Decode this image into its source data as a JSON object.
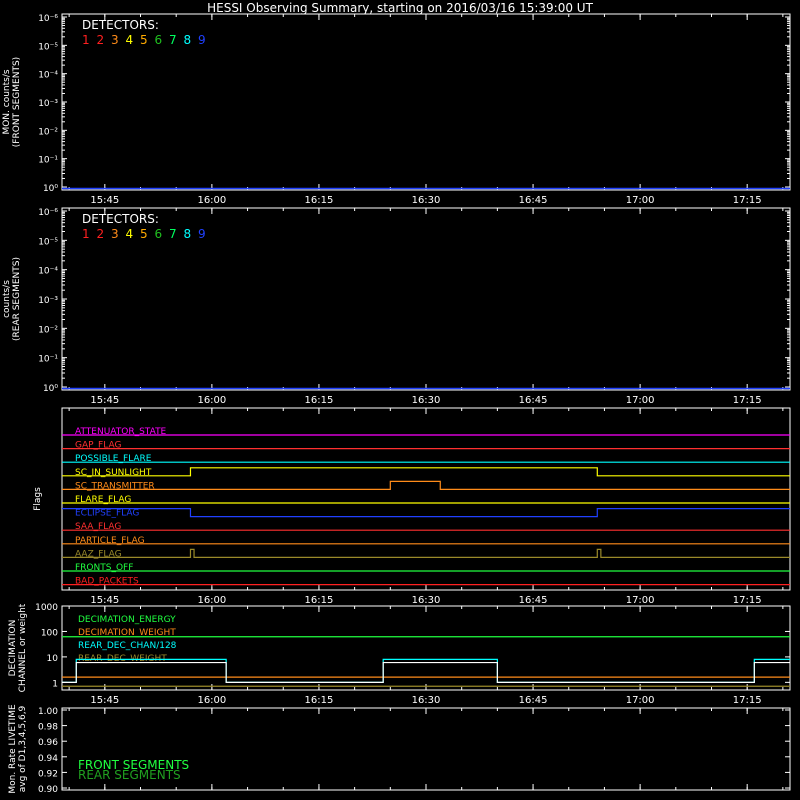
{
  "title": "HESSI Observing Summary, starting on 2016/03/16 15:39:00 UT",
  "time_axis": {
    "start": "15:39:00",
    "end": "17:21:00",
    "tick_labels": [
      "15:45",
      "16:00",
      "16:15",
      "16:30",
      "16:45",
      "17:00",
      "17:15"
    ],
    "tick_times": [
      "15:45",
      "16:00",
      "16:15",
      "16:30",
      "16:45",
      "17:00",
      "17:15"
    ]
  },
  "colors": {
    "background": "#000000",
    "axes": "#ffffff",
    "d1": "#ff2020",
    "d2": "#ff2020",
    "d3": "#ff8c1a",
    "d4": "#ffff00",
    "d5": "#ffaa00",
    "d6": "#20c020",
    "d7": "#00ff60",
    "d8": "#00ffff",
    "d9": "#2040ff"
  },
  "chart_data": [
    {
      "id": "front",
      "type": "line",
      "ylabel_lines": [
        "MON. counts/s",
        "(FRONT SEGMENTS)"
      ],
      "yscale": "log",
      "ylim": [
        1,
        100000
      ],
      "ytick_labels": [
        "10⁰",
        "10⁻¹",
        "10⁻²",
        "10⁻³",
        "10⁻⁴",
        "10⁻⁵",
        "10⁻⁶"
      ],
      "legend_title": "DETECTORS:",
      "legend": [
        {
          "label": "1",
          "color": "#ff2020"
        },
        {
          "label": "2",
          "color": "#ff2020"
        },
        {
          "label": "3",
          "color": "#ff8c1a"
        },
        {
          "label": "4",
          "color": "#ffff00"
        },
        {
          "label": "5",
          "color": "#ffaa00"
        },
        {
          "label": "6",
          "color": "#20c020"
        },
        {
          "label": "7",
          "color": "#00ff60"
        },
        {
          "label": "8",
          "color": "#00ffff"
        },
        {
          "label": "9",
          "color": "#2040ff"
        }
      ],
      "series": [
        {
          "color": "#2040ff",
          "x": [
            "15:39",
            "17:21"
          ],
          "y": [
            1,
            1
          ]
        }
      ]
    },
    {
      "id": "rear",
      "type": "line",
      "ylabel_lines": [
        "counts/s",
        "(REAR SEGMENTS)"
      ],
      "yscale": "log",
      "ylim": [
        1,
        100000
      ],
      "ytick_labels": [
        "10⁰",
        "10⁻¹",
        "10⁻²",
        "10⁻³",
        "10⁻⁴",
        "10⁻⁵",
        "10⁻⁶"
      ],
      "legend_title": "DETECTORS:",
      "legend": [
        {
          "label": "1",
          "color": "#ff2020"
        },
        {
          "label": "2",
          "color": "#ff2020"
        },
        {
          "label": "3",
          "color": "#ff8c1a"
        },
        {
          "label": "4",
          "color": "#ffff00"
        },
        {
          "label": "5",
          "color": "#ffaa00"
        },
        {
          "label": "6",
          "color": "#20c020"
        },
        {
          "label": "7",
          "color": "#00ff60"
        },
        {
          "label": "8",
          "color": "#00ffff"
        },
        {
          "label": "9",
          "color": "#2040ff"
        }
      ],
      "series": [
        {
          "color": "#2040ff",
          "x": [
            "15:39",
            "17:21"
          ],
          "y": [
            1,
            1
          ]
        }
      ]
    },
    {
      "id": "flags",
      "type": "line",
      "ylabel_lines": [
        "Flags"
      ],
      "flags": [
        {
          "name": "ATTENUATOR_STATE",
          "color": "#ff00ff",
          "changes": []
        },
        {
          "name": "GAP_FLAG",
          "color": "#ff3030",
          "changes": []
        },
        {
          "name": "POSSIBLE_FLARE",
          "color": "#00ffff",
          "changes": []
        },
        {
          "name": "SC_IN_SUNLIGHT",
          "color": "#ffff00",
          "changes": [
            [
              "15:39",
              0
            ],
            [
              "15:57",
              1
            ],
            [
              "16:54",
              0
            ]
          ]
        },
        {
          "name": "SC_TRANSMITTER",
          "color": "#ff8c1a",
          "changes": [
            [
              "15:39",
              0
            ],
            [
              "16:25",
              1
            ],
            [
              "16:32",
              0
            ]
          ]
        },
        {
          "name": "FLARE_FLAG",
          "color": "#ffff00",
          "changes": []
        },
        {
          "name": "ECLIPSE_FLAG",
          "color": "#2040ff",
          "changes": [
            [
              "15:39",
              1
            ],
            [
              "15:57",
              0
            ],
            [
              "16:54",
              1
            ]
          ]
        },
        {
          "name": "SAA_FLAG",
          "color": "#ff3030",
          "changes": []
        },
        {
          "name": "PARTICLE_FLAG",
          "color": "#ff8c1a",
          "changes": []
        },
        {
          "name": "AAZ_FLAG",
          "color": "#9a8a2a",
          "changes": [
            [
              "15:39",
              0
            ],
            [
              "15:57",
              1
            ],
            [
              "15:57.5",
              0
            ],
            [
              "16:54",
              1
            ],
            [
              "16:54.5",
              0
            ]
          ]
        },
        {
          "name": "FRONTS_OFF",
          "color": "#20ff40",
          "changes": []
        },
        {
          "name": "BAD_PACKETS",
          "color": "#ff2020",
          "changes": []
        }
      ]
    },
    {
      "id": "decimation",
      "type": "line",
      "ylabel_lines": [
        "DECIMATION",
        "CHANNEL or weight"
      ],
      "yscale": "log",
      "ylim": [
        0.5,
        1000
      ],
      "ytick_labels": [
        "1000",
        "100",
        "10",
        "1"
      ],
      "legend": [
        {
          "label": "DECIMATION_ENERGY",
          "color": "#20ff40"
        },
        {
          "label": "DECIMATION_WEIGHT",
          "color": "#ff8c1a"
        },
        {
          "label": "REAR_DEC_CHAN/128",
          "color": "#00ffff"
        },
        {
          "label": "REAR_DEC_WEIGHT",
          "color": "#9a8a2a"
        }
      ],
      "series": [
        {
          "name": "DECIMATION_ENERGY",
          "color": "#20ff40",
          "x": [
            "15:39",
            "17:21"
          ],
          "y": [
            62,
            62
          ]
        },
        {
          "name": "DECIMATION_WEIGHT",
          "color": "#ff8c1a",
          "x": [
            "15:39",
            "17:21"
          ],
          "y": [
            1.6,
            1.6
          ]
        },
        {
          "name": "REAR_DEC_CHAN/128",
          "color": "#00ffff",
          "steps": [
            [
              "15:39",
              1
            ],
            [
              "15:41",
              8
            ],
            [
              "16:02",
              1
            ],
            [
              "16:24",
              8
            ],
            [
              "16:40",
              1
            ],
            [
              "17:16",
              8
            ],
            [
              "17:21",
              8
            ]
          ]
        },
        {
          "name": "REAR_DEC_WEIGHT",
          "color": "#9a8a2a",
          "x": [
            "15:39",
            "17:21"
          ],
          "y": [
            0.7,
            0.7
          ]
        },
        {
          "name": "white",
          "color": "#ffffff",
          "steps": [
            [
              "15:39",
              1
            ],
            [
              "15:41",
              6
            ],
            [
              "16:02",
              1
            ],
            [
              "16:24",
              6
            ],
            [
              "16:40",
              1
            ],
            [
              "17:16",
              6
            ],
            [
              "17:21",
              6
            ]
          ]
        }
      ]
    },
    {
      "id": "livetime",
      "type": "line",
      "ylabel_lines": [
        "Mon. Rate LIVETIME",
        "avg of D1,3,4,5,6,9"
      ],
      "ylim": [
        0.9,
        1.0
      ],
      "ytick_labels": [
        "0.90",
        "0.92",
        "0.94",
        "0.96",
        "0.98",
        "1.00"
      ],
      "legend": [
        {
          "label": "FRONT SEGMENTS",
          "color": "#20ff40"
        },
        {
          "label": "REAR SEGMENTS",
          "color": "#20a020"
        }
      ],
      "series": []
    }
  ]
}
